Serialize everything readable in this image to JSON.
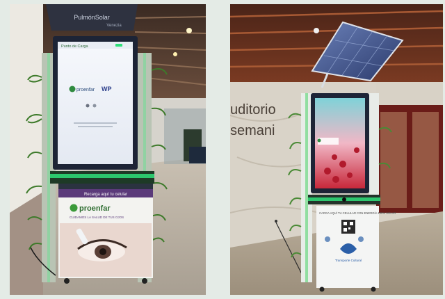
{
  "left_photo": {
    "canopy_text": "PulmónSolar",
    "canopy_subtext": "Venezia",
    "screen_header": "Punto de Carga",
    "screen_logo_left": "proenfar",
    "screen_logo_right": "WP",
    "cabinet_header": "Recarga aquí tu celular",
    "cabinet_brand": "proenfar",
    "cabinet_tagline": "CUIDAMOS LA SALUD DE TUS OJOS"
  },
  "right_photo": {
    "wall_line1": "uditorio",
    "wall_line2": "semani",
    "cabinet_header": "CARGA AQUÍ TU CELULAR CON ENERGÍA 100% SOLAR",
    "cabinet_footer": "Transporte Cultural"
  },
  "colors": {
    "kiosk_green": "#2fe07a",
    "screen_frame": "#1d2436",
    "screen_white": "#f4f7fb"
  }
}
